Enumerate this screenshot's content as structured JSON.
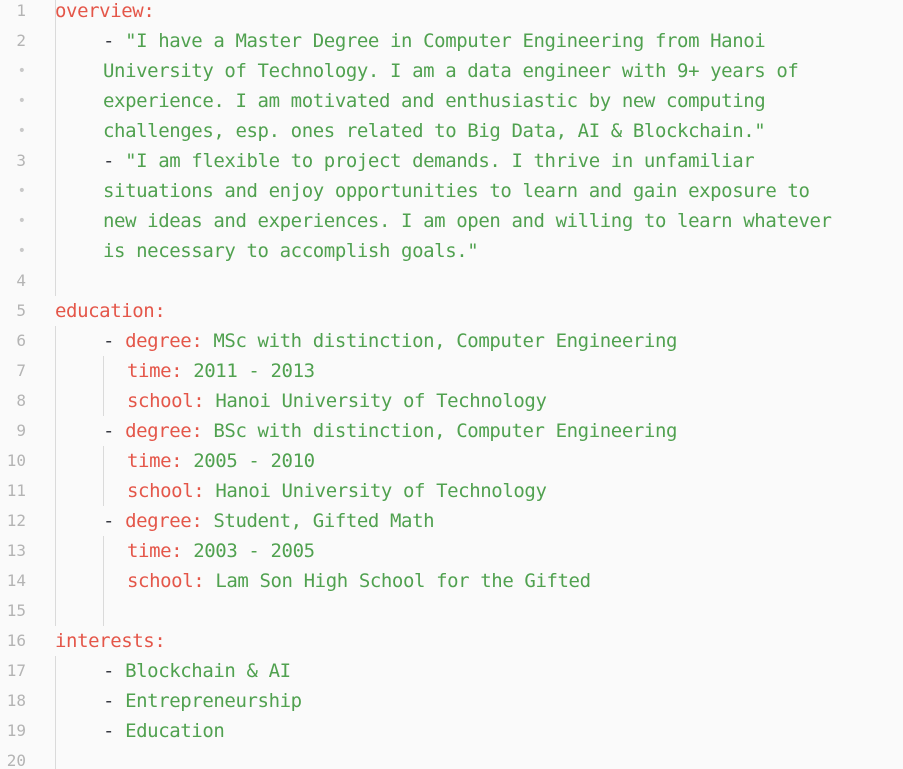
{
  "editor": {
    "lines": [
      {
        "n": "1",
        "indent": 0,
        "key": "overview",
        "colon": ":"
      },
      {
        "n": "2",
        "indent": 2,
        "dash": "- ",
        "str": "\"I have a Master Degree in Computer Engineering from Hanoi"
      },
      {
        "n": "•",
        "indent": 2,
        "str": "University of Technology. I am a data engineer with 9+ years of"
      },
      {
        "n": "•",
        "indent": 2,
        "str": "experience. I am motivated and enthusiastic by new computing"
      },
      {
        "n": "•",
        "indent": 2,
        "str": "challenges, esp. ones related to Big Data, AI & Blockchain.\""
      },
      {
        "n": "3",
        "indent": 2,
        "dash": "- ",
        "str": "\"I am flexible to project demands. I thrive in unfamiliar"
      },
      {
        "n": "•",
        "indent": 2,
        "str": "situations and enjoy opportunities to learn and gain exposure to"
      },
      {
        "n": "•",
        "indent": 2,
        "str": "new ideas and experiences. I am open and willing to learn whatever"
      },
      {
        "n": "•",
        "indent": 2,
        "str": "is necessary to accomplish goals.\""
      },
      {
        "n": "4",
        "indent": 0
      },
      {
        "n": "5",
        "indent": 0,
        "key": "education",
        "colon": ":"
      },
      {
        "n": "6",
        "indent": 2,
        "dash": "- ",
        "key": "degree",
        "colon": ": ",
        "str": "MSc with distinction, Computer Engineering"
      },
      {
        "n": "7",
        "indent": 3,
        "key": "time",
        "colon": ": ",
        "str": "2011 - 2013"
      },
      {
        "n": "8",
        "indent": 3,
        "key": "school",
        "colon": ": ",
        "str": "Hanoi University of Technology"
      },
      {
        "n": "9",
        "indent": 2,
        "dash": "- ",
        "key": "degree",
        "colon": ": ",
        "str": "BSc with distinction, Computer Engineering"
      },
      {
        "n": "10",
        "indent": 3,
        "key": "time",
        "colon": ": ",
        "str": "2005 - 2010"
      },
      {
        "n": "11",
        "indent": 3,
        "key": "school",
        "colon": ": ",
        "str": "Hanoi University of Technology"
      },
      {
        "n": "12",
        "indent": 2,
        "dash": "- ",
        "key": "degree",
        "colon": ": ",
        "str": "Student, Gifted Math"
      },
      {
        "n": "13",
        "indent": 3,
        "key": "time",
        "colon": ": ",
        "str": "2003 - 2005"
      },
      {
        "n": "14",
        "indent": 3,
        "key": "school",
        "colon": ": ",
        "str": "Lam Son High School for the Gifted"
      },
      {
        "n": "15",
        "indent": 0
      },
      {
        "n": "16",
        "indent": 0,
        "key": "interests",
        "colon": ":"
      },
      {
        "n": "17",
        "indent": 2,
        "dash": "- ",
        "str": "Blockchain & AI"
      },
      {
        "n": "18",
        "indent": 2,
        "dash": "- ",
        "str": "Entrepreneurship"
      },
      {
        "n": "19",
        "indent": 2,
        "dash": "- ",
        "str": "Education"
      },
      {
        "n": "20",
        "indent": 0
      }
    ]
  },
  "colors": {
    "background": "#fafafa",
    "line_number": "#b4b4b4",
    "key": "#e45649",
    "string": "#50a14f",
    "punctuation": "#383a42",
    "indent_guide": "#dadada"
  }
}
